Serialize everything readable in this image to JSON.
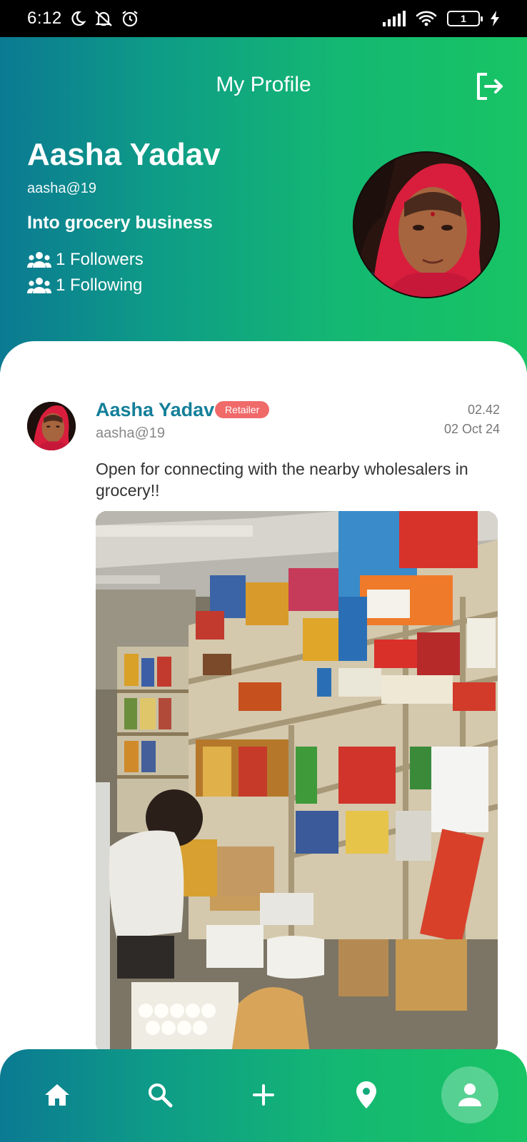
{
  "status_bar": {
    "time": "6:12",
    "battery": "1"
  },
  "header": {
    "title": "My Profile"
  },
  "profile": {
    "name": "Aasha Yadav",
    "handle": "aasha@19",
    "bio": "Into grocery business",
    "followers_label": "1 Followers",
    "following_label": "1 Following"
  },
  "post": {
    "author": "Aasha Yadav",
    "role": "Retailer",
    "handle": "aasha@19",
    "time": "02.42",
    "date": "02 Oct 24",
    "text": "Open for connecting with the nearby wholesalers in grocery!!"
  },
  "nav": {
    "items": [
      {
        "name": "home",
        "icon": "home-icon"
      },
      {
        "name": "search",
        "icon": "search-icon"
      },
      {
        "name": "add",
        "icon": "plus-icon"
      },
      {
        "name": "location",
        "icon": "location-pin-icon"
      },
      {
        "name": "profile",
        "icon": "person-icon",
        "active": true
      }
    ]
  },
  "colors": {
    "gradient_start": "#0b7a92",
    "gradient_end": "#18c464",
    "post_name": "#137f99",
    "badge": "#f06a6a"
  }
}
